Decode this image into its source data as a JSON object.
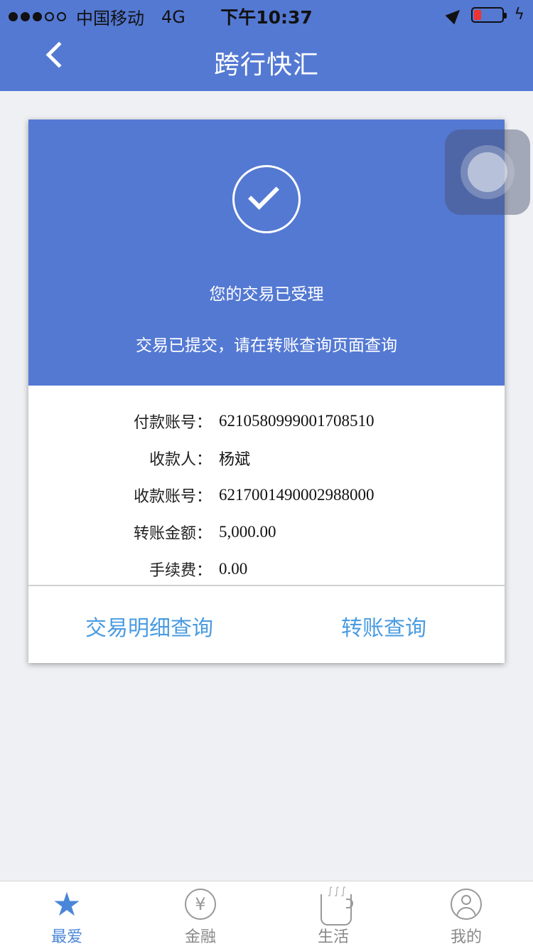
{
  "status_bar": {
    "carrier": "中国移动",
    "network": "4G",
    "time": "下午10:37",
    "signal_filled": 3,
    "signal_total": 5,
    "battery_color": "#e33333"
  },
  "header": {
    "title": "跨行快汇",
    "back_icon": "chevron-left-icon",
    "bg_color": "#5479d3"
  },
  "result": {
    "icon": "check-circle-icon",
    "accepted_text": "您的交易已受理",
    "submitted_text": "交易已提交，请在转账查询页面查询"
  },
  "details": [
    {
      "label": "付款账号：",
      "value": "6210580999001708510"
    },
    {
      "label": "收款人：",
      "value": "杨斌"
    },
    {
      "label": "收款账号：",
      "value": "6217001490002988000"
    },
    {
      "label": "转账金额：",
      "value": "5,000.00"
    },
    {
      "label": "手续费：",
      "value": "0.00"
    }
  ],
  "actions": {
    "detail_query": "交易明细查询",
    "transfer_query": "转账查询",
    "color": "#4a9be0"
  },
  "tabbar": {
    "items": [
      {
        "label": "最爱",
        "icon": "star-icon",
        "active": true
      },
      {
        "label": "金融",
        "icon": "yen-icon",
        "active": false
      },
      {
        "label": "生活",
        "icon": "coffee-cup-icon",
        "active": false
      },
      {
        "label": "我的",
        "icon": "user-icon",
        "active": false
      }
    ],
    "active_color": "#4a86d8"
  }
}
